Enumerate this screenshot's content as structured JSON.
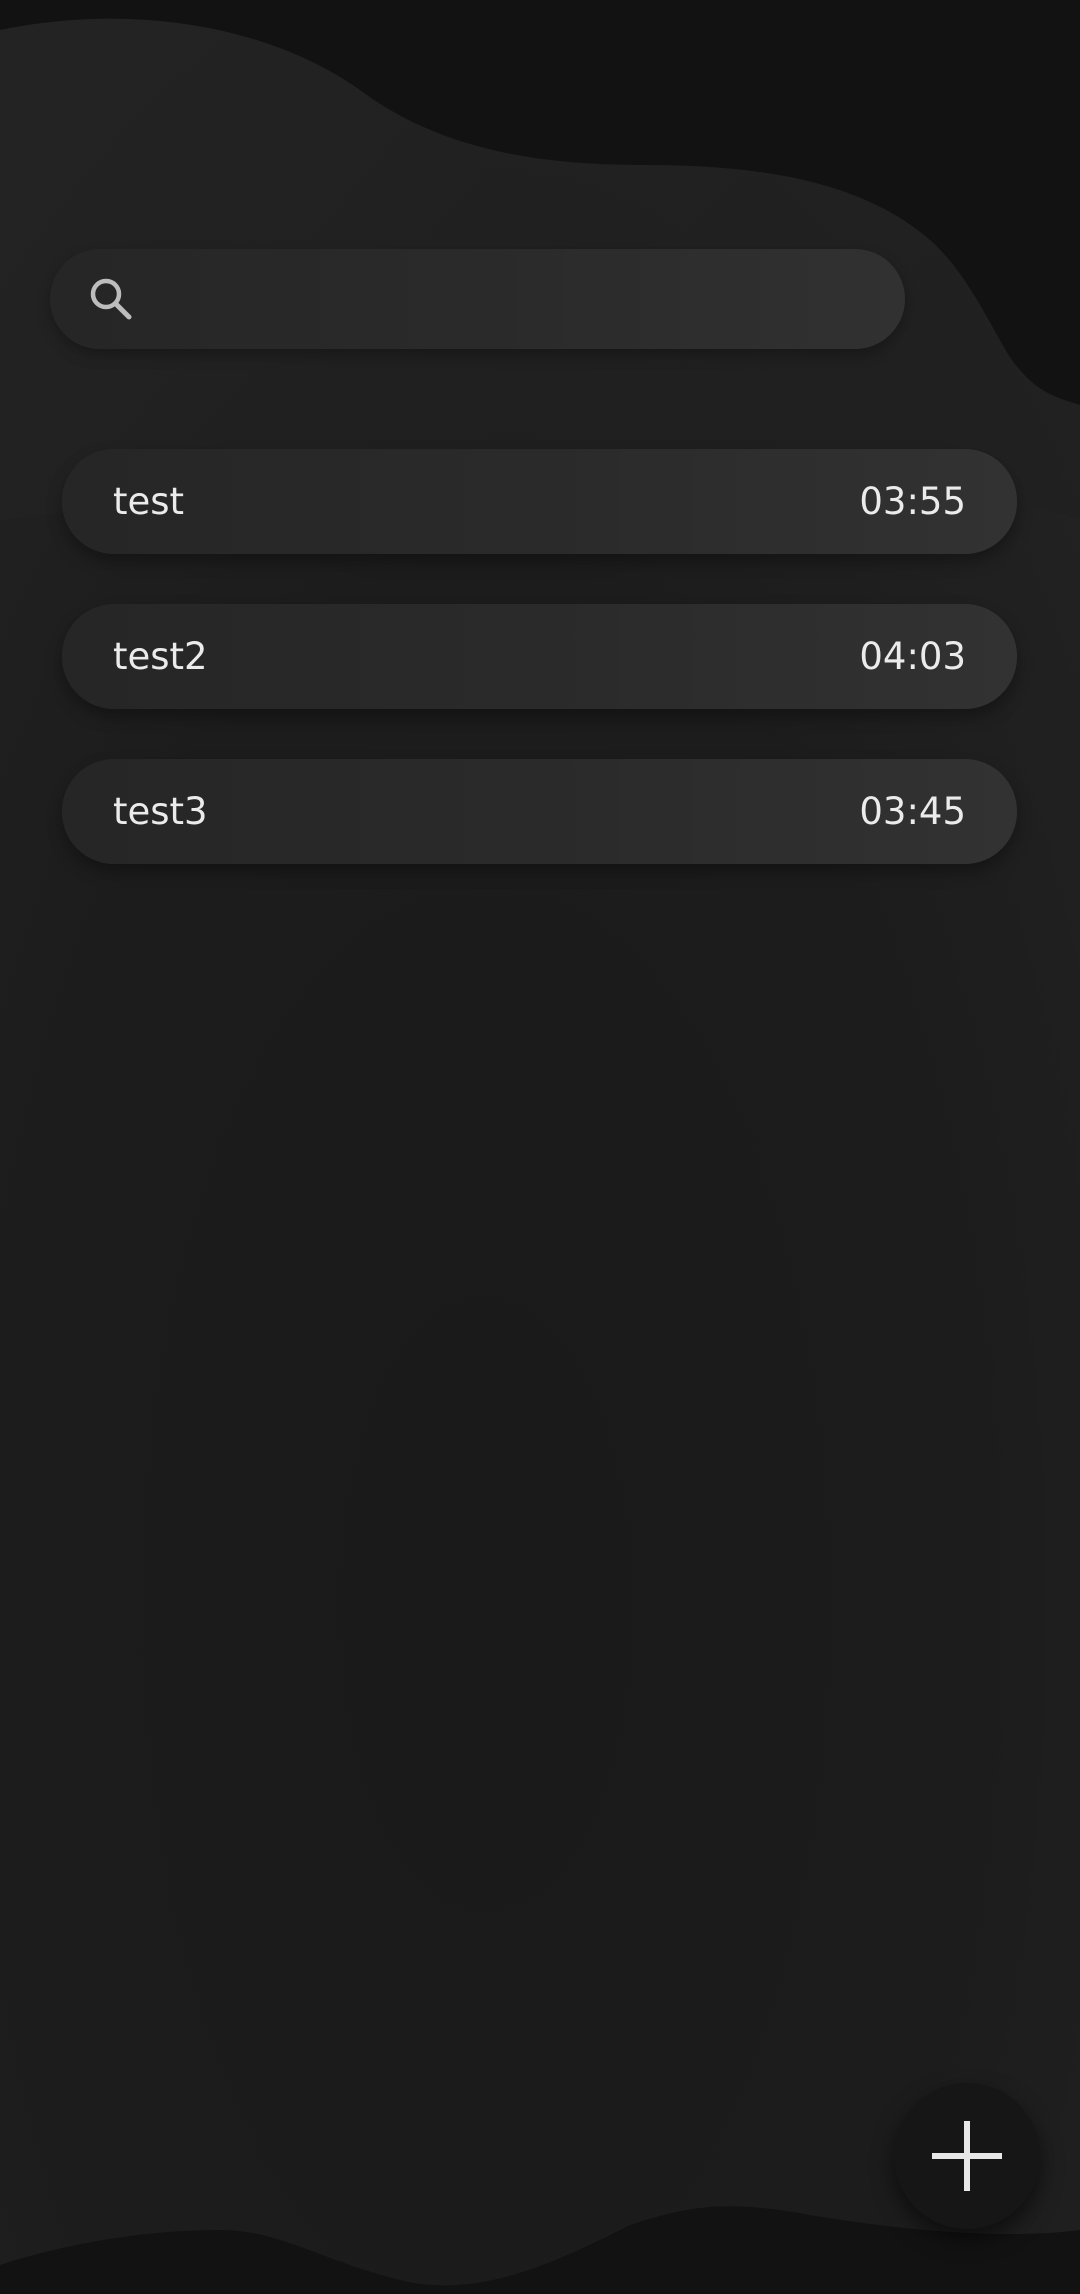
{
  "search": {
    "placeholder": "",
    "value": "",
    "icon": "search-icon"
  },
  "items": [
    {
      "name": "test",
      "duration": "03:55"
    },
    {
      "name": "test2",
      "duration": "04:03"
    },
    {
      "name": "test3",
      "duration": "03:45"
    }
  ],
  "fab": {
    "icon": "plus-icon"
  },
  "colors": {
    "background": "#1b1b1b",
    "wave": "#222222",
    "surface": "#2b2b2b",
    "text": "#ebebeb",
    "fab": "#161616"
  }
}
